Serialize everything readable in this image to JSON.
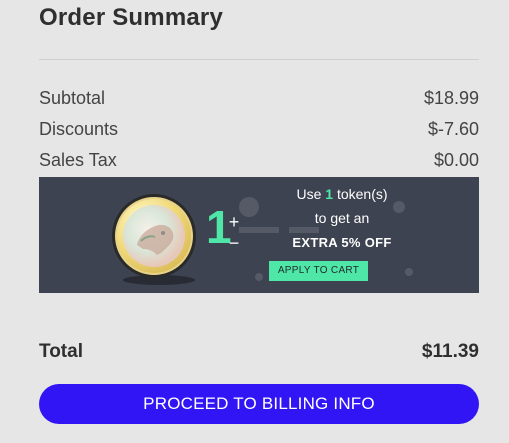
{
  "summary": {
    "title": "Order Summary",
    "subtotal_label": "Subtotal",
    "subtotal_value": "$18.99",
    "discounts_label": "Discounts",
    "discounts_value": "$-7.60",
    "tax_label": "Sales Tax",
    "tax_value": "$0.00",
    "total_label": "Total",
    "total_value": "$11.39"
  },
  "promo": {
    "token_count": "1",
    "plus_symbol": "+",
    "minus_symbol": "−",
    "line1_prefix": "Use ",
    "line1_count": "1",
    "line1_suffix": " token(s)",
    "line2": "to get an",
    "line3": "EXTRA 5% OFF",
    "apply_label": "APPLY TO CART",
    "coin_icon": "token-coin-icon"
  },
  "actions": {
    "proceed_label": "PROCEED TO BILLING INFO"
  },
  "colors": {
    "accent_green": "#4ee7a8",
    "promo_bg": "#3e4351",
    "proceed_bg": "#3215f5"
  }
}
